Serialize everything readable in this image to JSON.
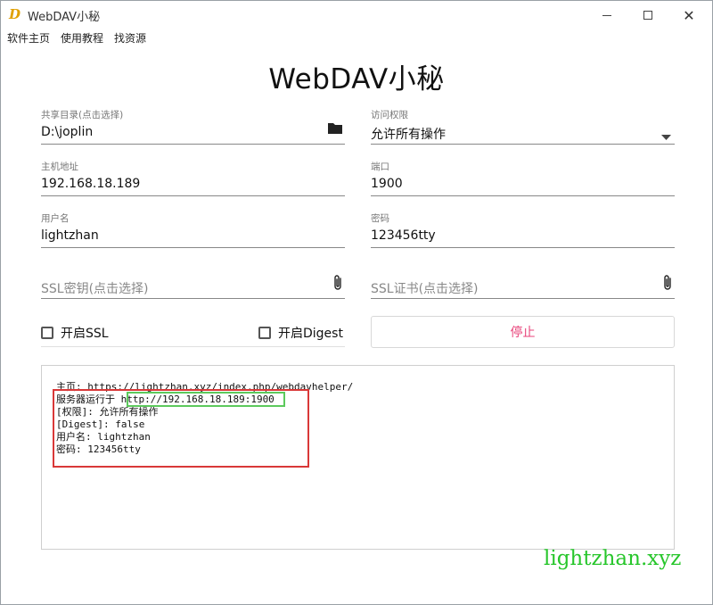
{
  "window": {
    "app_icon_glyph": "D",
    "title": "WebDAV小秘",
    "controls": {
      "minimize": "",
      "maximize": "",
      "close": "✕"
    }
  },
  "menu": {
    "items": [
      "软件主页",
      "使用教程",
      "找资源"
    ]
  },
  "heading": "WebDAV小秘",
  "form": {
    "share_dir": {
      "label": "共享目录(点击选择)",
      "value": "D:\\joplin",
      "icon": "folder-icon"
    },
    "access": {
      "label": "访问权限",
      "value": "允许所有操作",
      "icon": "dropdown-arrow-icon"
    },
    "host": {
      "label": "主机地址",
      "value": "192.168.18.189"
    },
    "port": {
      "label": "端口",
      "value": "1900"
    },
    "username": {
      "label": "用户名",
      "value": "lightzhan"
    },
    "password": {
      "label": "密码",
      "value": "123456tty"
    },
    "ssl_key": {
      "placeholder": "SSL密钥(点击选择)",
      "icon": "paperclip-icon"
    },
    "ssl_cert": {
      "placeholder": "SSL证书(点击选择)",
      "icon": "paperclip-icon"
    },
    "enable_ssl": {
      "label": "开启SSL",
      "checked": false
    },
    "enable_digest": {
      "label": "开启Digest",
      "checked": false
    },
    "stop_button": "停止"
  },
  "console": {
    "lines": [
      "主页: https://lightzhan.xyz/index.php/webdavhelper/",
      "服务器运行于 http://192.168.18.189:1900",
      "[权限]: 允许所有操作",
      "[Digest]: false",
      "用户名: lightzhan",
      "密码: 123456tty"
    ]
  },
  "annotations": {
    "red_box_color": "#d93838",
    "green_box_color": "#5cc95c"
  },
  "watermark": "lightzhan.xyz",
  "colors": {
    "stop_text": "#e8437a",
    "watermark": "#27c62b",
    "app_icon": "#e0a000"
  }
}
